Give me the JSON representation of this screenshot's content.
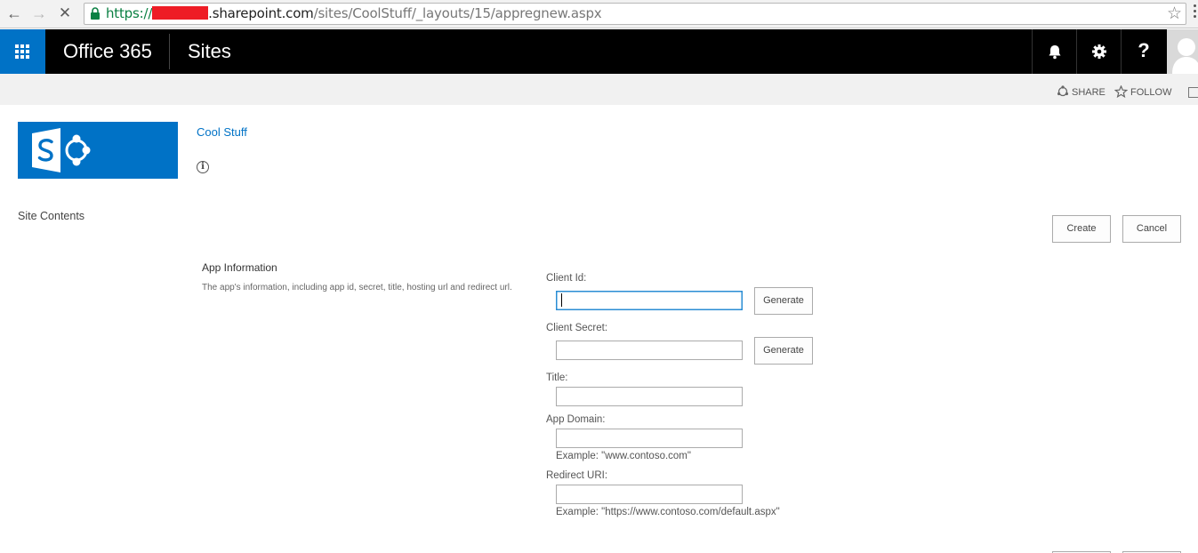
{
  "browser": {
    "url_scheme": "https://",
    "url_host": ".sharepoint.com",
    "url_path": "/sites/CoolStuff/_layouts/15/appregnew.aspx",
    "icons": [
      "back-arrow-icon",
      "forward-arrow-icon",
      "stop-icon",
      "lock-icon",
      "star-icon",
      "menu-icon"
    ]
  },
  "suite": {
    "brand": "Office 365",
    "app": "Sites",
    "help_glyph": "?",
    "accent": "#0072c6",
    "icons": [
      "app-launcher-icon",
      "bell-icon",
      "gear-icon",
      "help-icon",
      "avatar-icon"
    ]
  },
  "ribbon": {
    "share": "SHARE",
    "follow": "FOLLOW"
  },
  "site": {
    "title": "Cool Stuff",
    "info_glyph": "i"
  },
  "nav": {
    "site_contents": "Site Contents"
  },
  "actions": {
    "create": "Create",
    "cancel": "Cancel"
  },
  "form": {
    "section_title": "App Information",
    "section_description": "The app's information, including app id, secret, title, hosting url and redirect url.",
    "generate": "Generate",
    "fields": {
      "client_id": {
        "label": "Client Id:",
        "value": ""
      },
      "client_secret": {
        "label": "Client Secret:",
        "value": ""
      },
      "title": {
        "label": "Title:",
        "value": ""
      },
      "app_domain": {
        "label": "App Domain:",
        "value": "",
        "example": "Example: \"www.contoso.com\""
      },
      "redirect_uri": {
        "label": "Redirect URI:",
        "value": "",
        "example": "Example: \"https://www.contoso.com/default.aspx\""
      }
    }
  }
}
